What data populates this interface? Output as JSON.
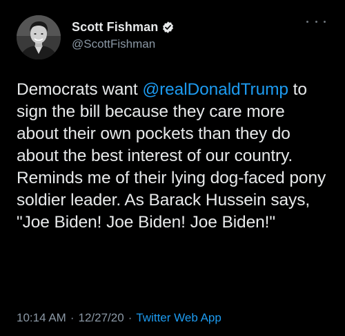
{
  "author": {
    "display_name": "Scott Fishman",
    "handle": "@ScottFishman",
    "verified_icon": "verified-badge-icon",
    "colors": {
      "badge": "#e7e9ea",
      "badge_check": "#000000"
    }
  },
  "menu": {
    "icon": "more-options-icon"
  },
  "tweet": {
    "text_before_mention": "Democrats want ",
    "mention": "@realDonaldTrump",
    "text_after_mention": " to sign the bill because they care more about their own pockets than they do about the best interest of our country. Reminds me of their lying dog-faced pony soldier leader. As Barack Hussein says, \"Joe Biden! Joe Biden! Joe Biden!\""
  },
  "meta": {
    "time": "10:14 AM",
    "separator": "·",
    "date": "12/27/20",
    "source": "Twitter Web App"
  },
  "colors": {
    "background": "#000000",
    "text": "#e7e9ea",
    "secondary": "#8b98a5",
    "link": "#1d9bf0"
  }
}
